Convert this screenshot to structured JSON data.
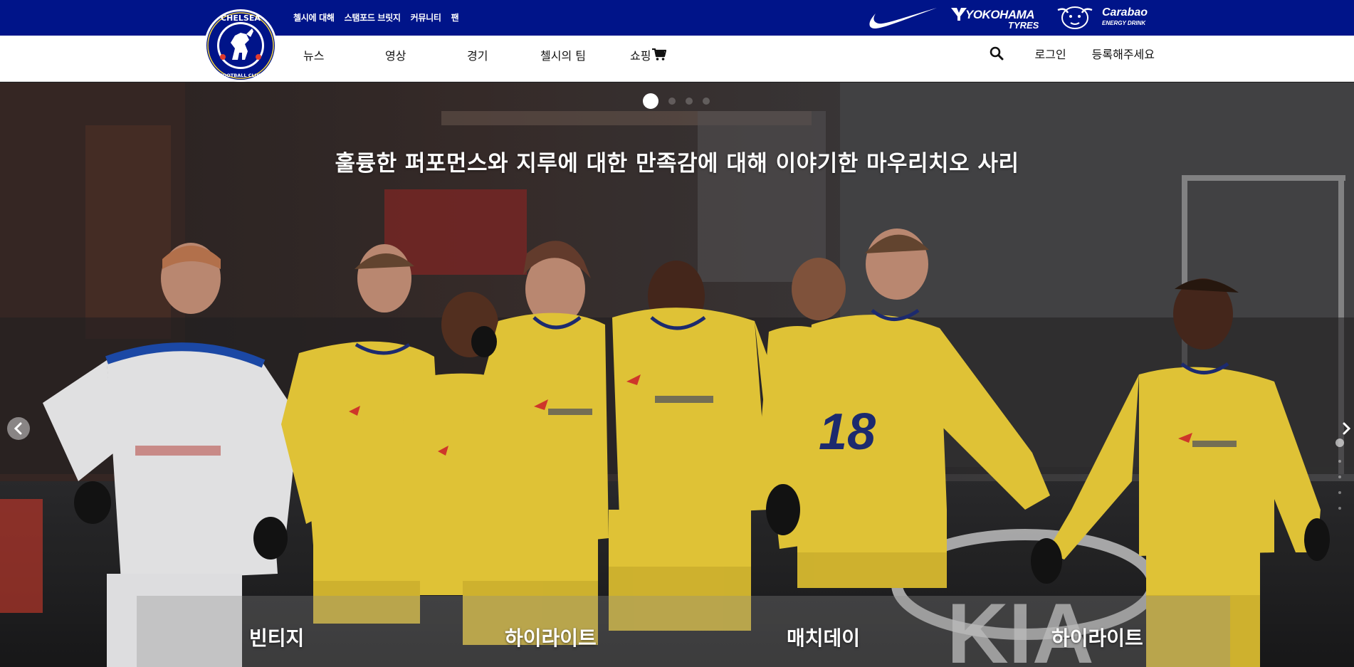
{
  "top_links": [
    "첼시에 대해",
    "스탬포드 브릿지",
    "커뮤니티",
    "팬"
  ],
  "sponsors": {
    "yokohama_line1": "YOKOHAMA",
    "yokohama_line2": "TYRES",
    "carabao_line1": "Carabao",
    "carabao_line2": "ENERGY DRINK"
  },
  "crest": {
    "text_top": "CHELSEA",
    "text_bottom": "FOOTBALL CLUB"
  },
  "main_nav": [
    "뉴스",
    "영상",
    "경기",
    "첼시의 팀",
    "쇼핑"
  ],
  "nav_right": {
    "login": "로그인",
    "register": "등록해주세요"
  },
  "hero": {
    "headline": "훌륭한 퍼포먼스와 지루에 대한 만족감에 대해 이야기한 마우리치오 사리",
    "slide_count": 4,
    "active_slide": 1,
    "categories": [
      "빈티지",
      "하이라이트",
      "매치데이",
      "하이라이트"
    ]
  },
  "colors": {
    "chelsea_blue": "#001489",
    "kit_yellow": "#f2d33b",
    "kit_navy": "#1f2e78",
    "accent_red": "#e03b2e"
  },
  "icons": [
    "search-icon",
    "cart-icon",
    "chevron-left-icon",
    "chevron-right-icon",
    "nike-swoosh-logo"
  ]
}
